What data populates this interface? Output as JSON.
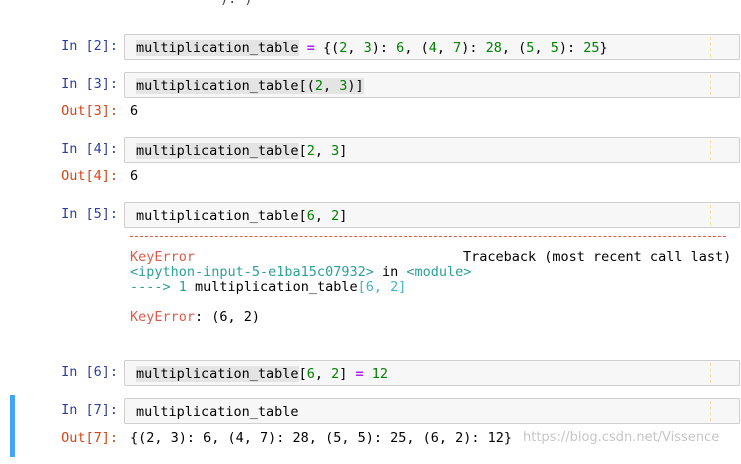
{
  "cells": [
    {
      "in_label": "In [2]:",
      "code": [
        "multiplication_table",
        " = {(2, 3): 6, (4, 7): 28, (5, 5): 25}"
      ]
    },
    {
      "in_label": "In [3]:",
      "code": [
        "multiplication_table",
        "[(2, 3)]"
      ],
      "out_label": "Out[3]:",
      "output": "6"
    },
    {
      "in_label": "In [4]:",
      "code": [
        "multiplication_table",
        "[2, 3]"
      ],
      "out_label": "Out[4]:",
      "output": "6"
    },
    {
      "in_label": "In [5]:",
      "code": [
        "multiplication_table",
        "[6, 2]"
      ],
      "traceback": {
        "separator": "---------------------------------------------------------------------------",
        "error_name": "KeyError",
        "header": "Traceback (most recent call last)",
        "location": "<ipython-input-5-e1ba15c07932>",
        "in_word": " in ",
        "module": "<module>",
        "arrow": "----> 1 ",
        "line_code": "multiplication_table",
        "line_rest": "[6, 2]",
        "final_name": "KeyError",
        "final_msg": ": (6, 2)"
      }
    },
    {
      "in_label": "In [6]:",
      "code": [
        "multiplication_table",
        "[6, 2] = 12"
      ]
    },
    {
      "in_label": "In [7]:",
      "code": [
        "multiplication_table",
        ""
      ],
      "out_label": "Out[7]:",
      "output": "{(2, 3): 6, (4, 7): 28, (5, 5): 25, (6, 2): 12}"
    }
  ],
  "top_cut_text": "): )",
  "watermark": "https://blog.csdn.net/Vissence"
}
